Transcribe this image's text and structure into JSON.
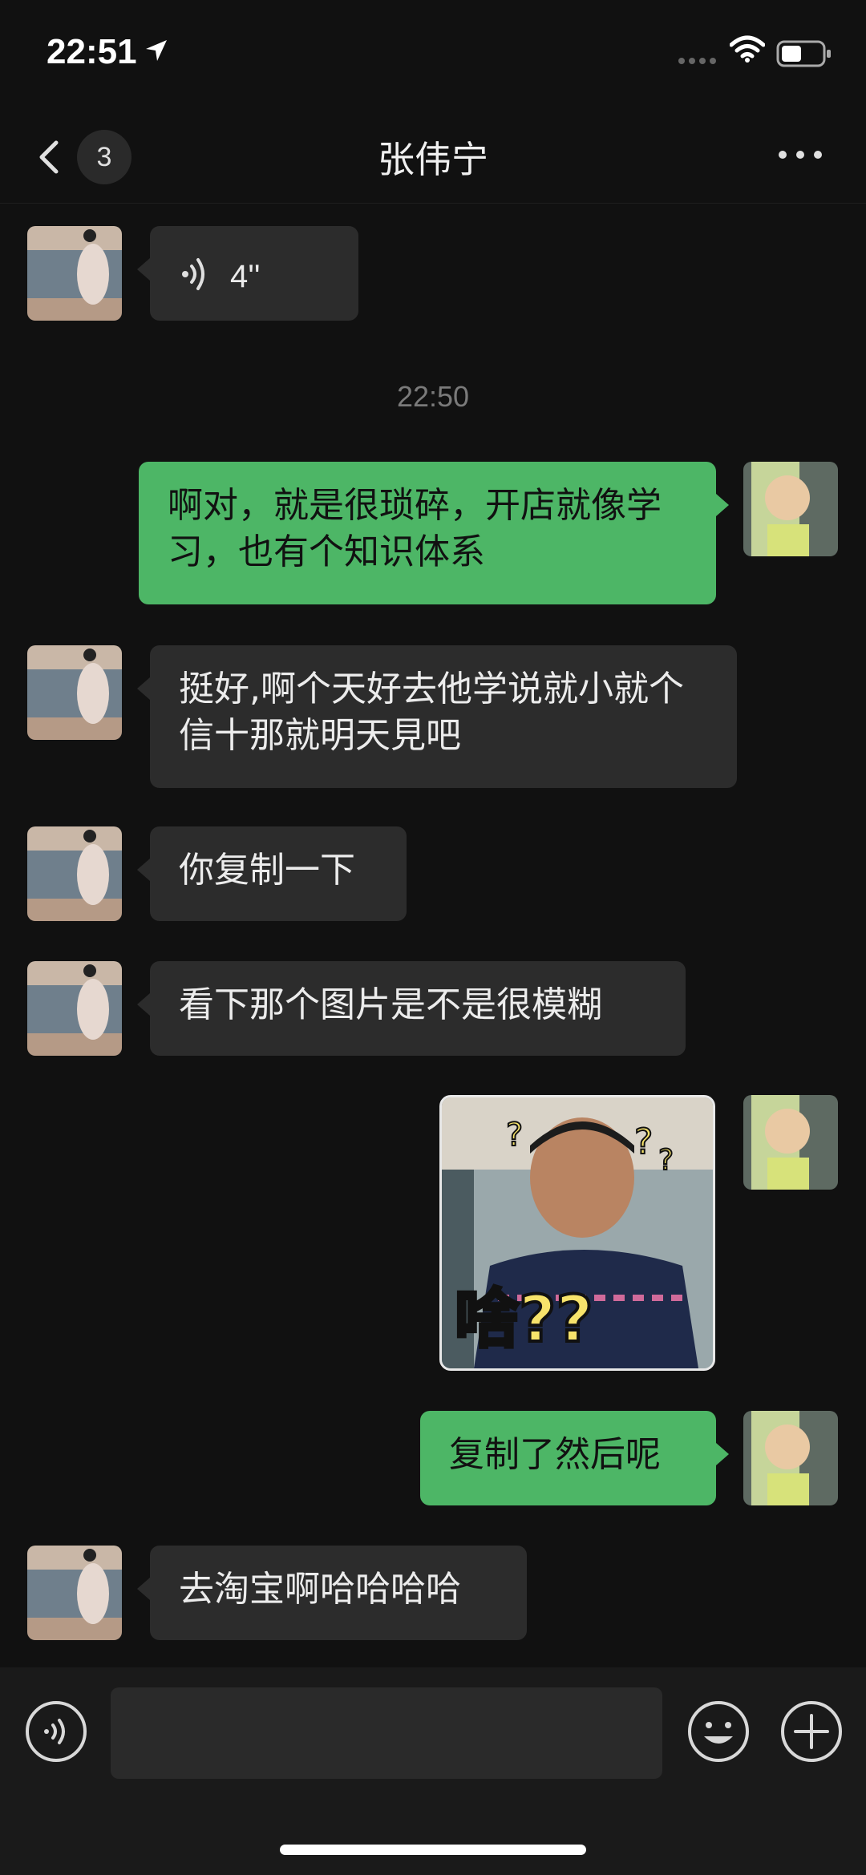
{
  "status_bar": {
    "time": "22:51"
  },
  "nav": {
    "unread_count": "3",
    "title": "张伟宁"
  },
  "messages": {
    "voice": {
      "duration": "4''"
    },
    "timestamp": "22:50",
    "m1": "啊对，就是很琐碎，开店就像学习，也有个知识体系",
    "m2": "挺好,啊个天好去他学说就小就个信十那就明天見吧",
    "m3": "你复制一下",
    "m4": "看下那个图片是不是很模糊",
    "sticker_caption": "啥??",
    "m5": "复制了然后呢",
    "m6": "去淘宝啊哈哈哈哈"
  },
  "input": {
    "placeholder": ""
  },
  "colors": {
    "outgoing_bubble": "#4db666",
    "incoming_bubble": "#2c2c2c",
    "background": "#111111"
  }
}
